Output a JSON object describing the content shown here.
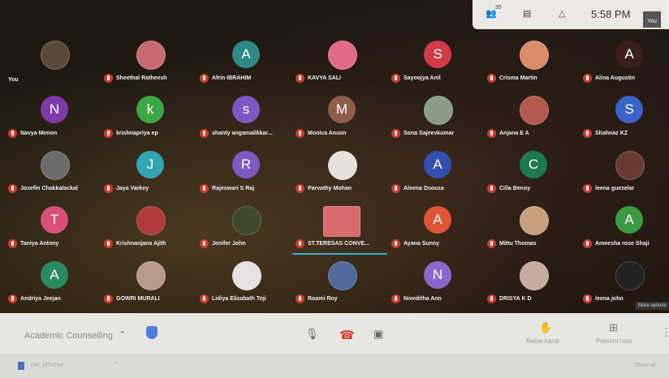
{
  "topbar": {
    "participants_icon": "people-icon",
    "participants_count": "35",
    "chat_icon": "chat-icon",
    "activities_icon": "shapes-icon",
    "time": "5:58 PM",
    "self_label": "You"
  },
  "participants": [
    {
      "name": "You",
      "initial": "",
      "color": "#5a4a3a",
      "photo": true
    },
    {
      "name": "Sheethal Ratheesh",
      "initial": "",
      "color": "#c96a72",
      "photo": true
    },
    {
      "name": "Afrin IBRAHIM",
      "initial": "A",
      "color": "#2d8a86"
    },
    {
      "name": "KAVYA SALI",
      "initial": "",
      "color": "#e06a84",
      "photo": true
    },
    {
      "name": "Sayoojya Anil",
      "initial": "S",
      "color": "#d13b4a"
    },
    {
      "name": "Crisma Martin",
      "initial": "",
      "color": "#d98b6a",
      "photo": true
    },
    {
      "name": "Alina Augustin",
      "initial": "A",
      "color": "#3a1f1b"
    },
    {
      "name": "Navya Menon",
      "initial": "N",
      "color": "#7c3aa8"
    },
    {
      "name": "krishnapriya ep",
      "initial": "k",
      "color": "#39a845"
    },
    {
      "name": "shanty angamalikkar...",
      "initial": "s",
      "color": "#7c58c2"
    },
    {
      "name": "Monica Anson",
      "initial": "M",
      "color": "#8e5e4b"
    },
    {
      "name": "Sona Sajeevkumar",
      "initial": "",
      "color": "#8b9c84",
      "photo": true
    },
    {
      "name": "Anjana E A",
      "initial": "",
      "color": "#b2584f",
      "photo": true
    },
    {
      "name": "Shahnaz KZ",
      "initial": "S",
      "color": "#3a62c9"
    },
    {
      "name": "Josefin Chakkalackal",
      "initial": "",
      "color": "#6b6b6b",
      "photo": true
    },
    {
      "name": "Jaya Varkey",
      "initial": "J",
      "color": "#33a4b3"
    },
    {
      "name": "Rajeswari S Raj",
      "initial": "R",
      "color": "#7c5ac2"
    },
    {
      "name": "Parvathy Mohan",
      "initial": "",
      "color": "#e8e0dc",
      "photo": true
    },
    {
      "name": "Aleena Dsouza",
      "initial": "A",
      "color": "#3350b0"
    },
    {
      "name": "Cilla Benoy",
      "initial": "C",
      "color": "#1d7a4d"
    },
    {
      "name": "leena guezelar",
      "initial": "",
      "color": "#6a3a30",
      "photo": true
    },
    {
      "name": "Taniya Antony",
      "initial": "T",
      "color": "#d8507a"
    },
    {
      "name": "Krishnanjana Ajith",
      "initial": "",
      "color": "#b13a3a",
      "photo": true
    },
    {
      "name": "Jenifer John",
      "initial": "",
      "color": "#3b4a2c",
      "photo": true
    },
    {
      "name": "ST.TERESAS CONVE...",
      "initial": "",
      "color": "#d96b6e",
      "photo": true,
      "active": true
    },
    {
      "name": "Ayana Sunny",
      "initial": "A",
      "color": "#e05536"
    },
    {
      "name": "Mittu Thomas",
      "initial": "",
      "color": "#c9a07c",
      "photo": true
    },
    {
      "name": "Ameesha rose Shaji",
      "initial": "A",
      "color": "#3b9b43"
    },
    {
      "name": "Andriya Jeejan",
      "initial": "A",
      "color": "#2a8a5f"
    },
    {
      "name": "GOWRI MURALI",
      "initial": "",
      "color": "#b89a8a",
      "photo": true
    },
    {
      "name": "Lidiya Elizabath Toji",
      "initial": "",
      "color": "#e7e0e4",
      "photo": true
    },
    {
      "name": "Roami Roy",
      "initial": "",
      "color": "#4f6a9b",
      "photo": true
    },
    {
      "name": "Niveditha Ann",
      "initial": "N",
      "color": "#8a68c9"
    },
    {
      "name": "DRISYA K D",
      "initial": "",
      "color": "#c7aaa0",
      "photo": true
    },
    {
      "name": "leena john",
      "initial": "",
      "color": "#222",
      "photo": true
    }
  ],
  "more_options_tooltip": "More options",
  "bottombar": {
    "meeting_title": "Academic Counselling",
    "chevron_icon": "chevron-up-icon",
    "shield_icon": "shield-icon",
    "mic_icon": "mic-icon",
    "hangup_icon": "hangup-icon",
    "camera_icon": "camera-icon",
    "raise_hand_label": "Raise hand",
    "present_now_label": "Present now",
    "more_icon": "more-vert-icon"
  },
  "downloadbar": {
    "file_name": "DM_MTvFee",
    "show_all_label": "Show all"
  }
}
